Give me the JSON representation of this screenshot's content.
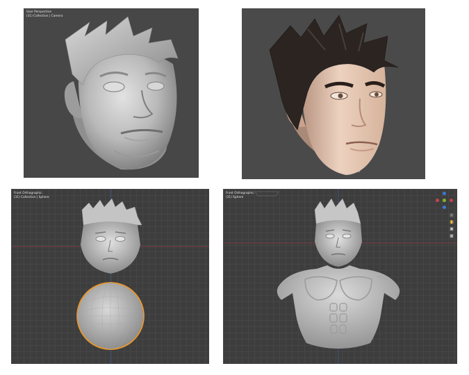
{
  "panels": {
    "top_left": {
      "view_name": "User Perspective",
      "collection": "(31) Collection | Camera"
    },
    "top_right": {},
    "bottom_left": {
      "view_name": "Front Orthographic",
      "collection": "(31) Collection | Sphere"
    },
    "bottom_right": {
      "view_name": "Front Orthographic",
      "collection": "(31) Sphere"
    }
  },
  "colors": {
    "viewport_bg": "#3d3d3d",
    "render_bg": "#4a4a4a",
    "clay": "#bdbdbd",
    "skin": "#e6c5ae",
    "hair": "#2b2421",
    "selection_outline": "#e8962d",
    "axis_x": "#c9414f",
    "axis_y": "#7fb62e",
    "axis_z": "#3c78d8"
  },
  "icons": [
    "navigation-gizmo-icon",
    "zoom-icon",
    "pan-hand-icon",
    "camera-view-icon",
    "grid-view-icon"
  ]
}
